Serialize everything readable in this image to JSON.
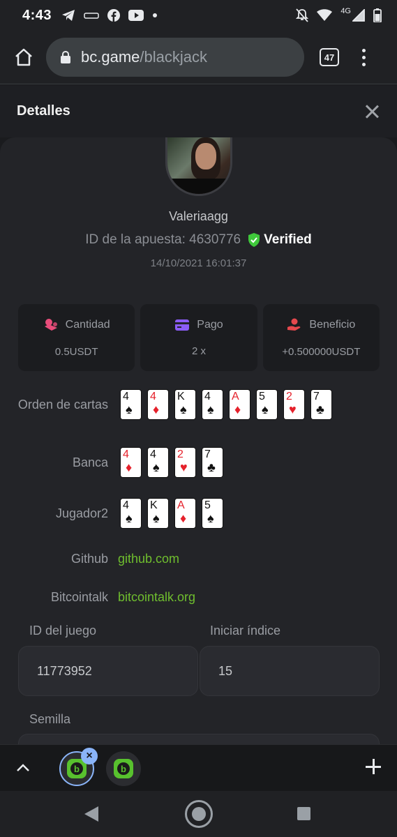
{
  "status_bar": {
    "time": "4:43",
    "network": "4G"
  },
  "browser": {
    "url_host": "bc.game",
    "url_path": "/blackjack",
    "tab_count": "47"
  },
  "modal": {
    "title": "Detalles",
    "username": "Valeriaagg",
    "bet_id_label": "ID de la apuesta: 4630776",
    "verified_label": "Verified",
    "timestamp": "14/10/2021 16:01:37"
  },
  "stats": [
    {
      "label": "Cantidad",
      "value": "0.5USDT",
      "icon": "coins-icon",
      "color": "#e94d7b"
    },
    {
      "label": "Pago",
      "value": "2 x",
      "icon": "card-icon",
      "color": "#8b5cf6"
    },
    {
      "label": "Beneficio",
      "value": "+0.500000USDT",
      "icon": "hand-coin-icon",
      "color": "#e5484d"
    }
  ],
  "card_rows": {
    "order": {
      "label": "Orden de cartas",
      "cards": [
        {
          "rank": "4",
          "suit": "♠",
          "red": false
        },
        {
          "rank": "4",
          "suit": "♦",
          "red": true
        },
        {
          "rank": "K",
          "suit": "♠",
          "red": false
        },
        {
          "rank": "4",
          "suit": "♠",
          "red": false
        },
        {
          "rank": "A",
          "suit": "♦",
          "red": true
        },
        {
          "rank": "5",
          "suit": "♠",
          "red": false
        },
        {
          "rank": "2",
          "suit": "♥",
          "red": true
        },
        {
          "rank": "7",
          "suit": "♣",
          "red": false
        }
      ]
    },
    "bank": {
      "label": "Banca",
      "cards": [
        {
          "rank": "4",
          "suit": "♦",
          "red": true
        },
        {
          "rank": "4",
          "suit": "♠",
          "red": false
        },
        {
          "rank": "2",
          "suit": "♥",
          "red": true
        },
        {
          "rank": "7",
          "suit": "♣",
          "red": false
        }
      ]
    },
    "player": {
      "label": "Jugador2",
      "cards": [
        {
          "rank": "4",
          "suit": "♠",
          "red": false
        },
        {
          "rank": "K",
          "suit": "♠",
          "red": false
        },
        {
          "rank": "A",
          "suit": "♦",
          "red": true
        },
        {
          "rank": "5",
          "suit": "♠",
          "red": false
        }
      ]
    }
  },
  "links": {
    "github_label": "Github",
    "github_value": "github.com",
    "bitcointalk_label": "Bitcointalk",
    "bitcointalk_value": "bitcointalk.org"
  },
  "fields": {
    "game_id_label": "ID del juego",
    "game_id_value": "11773952",
    "start_index_label": "Iniciar índice",
    "start_index_value": "15",
    "seed_label": "Semilla"
  },
  "colors": {
    "link_green": "#6fbe2e",
    "verified_green": "#3fc83b",
    "tab_active_ring": "#8ab4f8"
  }
}
